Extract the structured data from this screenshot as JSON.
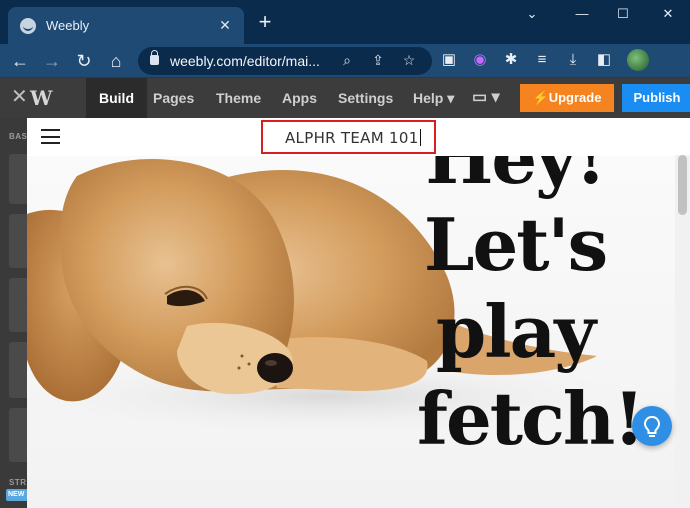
{
  "browser": {
    "tab": {
      "title": "Weebly",
      "favicon": "weebly-favicon"
    },
    "new_tab": "+",
    "window_controls": {
      "collapse": "⌄",
      "minimize": "—",
      "maximize": "☐",
      "close": "✕"
    },
    "url": "weebly.com/editor/mai...",
    "nav": {
      "back": "←",
      "forward": "→",
      "reload": "↻",
      "home": "⌂"
    },
    "omnibox_icons": {
      "zoom": "⌕",
      "share": "⇪",
      "bookmark": "☆"
    },
    "extensions": [
      "▣",
      "◉",
      "✱",
      "≡",
      "⤓",
      "◧"
    ]
  },
  "editor": {
    "close": "✕",
    "logo": "W",
    "menu": [
      "Build",
      "Pages",
      "Theme",
      "Apps",
      "Settings",
      "Help ▾"
    ],
    "device_toggle": "▭ ▾",
    "upgrade_label": "⚡Upgrade",
    "publish_label": "Publish"
  },
  "sidepanel": {
    "basic_label": "BAS",
    "structure_label": "STR",
    "new_badge": "NEW"
  },
  "site": {
    "title": "ALPHR TEAM 101",
    "hero_lines": [
      "Hey!",
      "Let's",
      "play",
      "fetch!"
    ]
  },
  "colors": {
    "tabstrip": "#0b2b4d",
    "toolbar": "#1f4a73",
    "editor_bar": "#3c3c3c",
    "upgrade": "#f5831f",
    "publish": "#1a8df2",
    "highlight": "#d81e1e",
    "help_button": "#2f8fe4"
  }
}
